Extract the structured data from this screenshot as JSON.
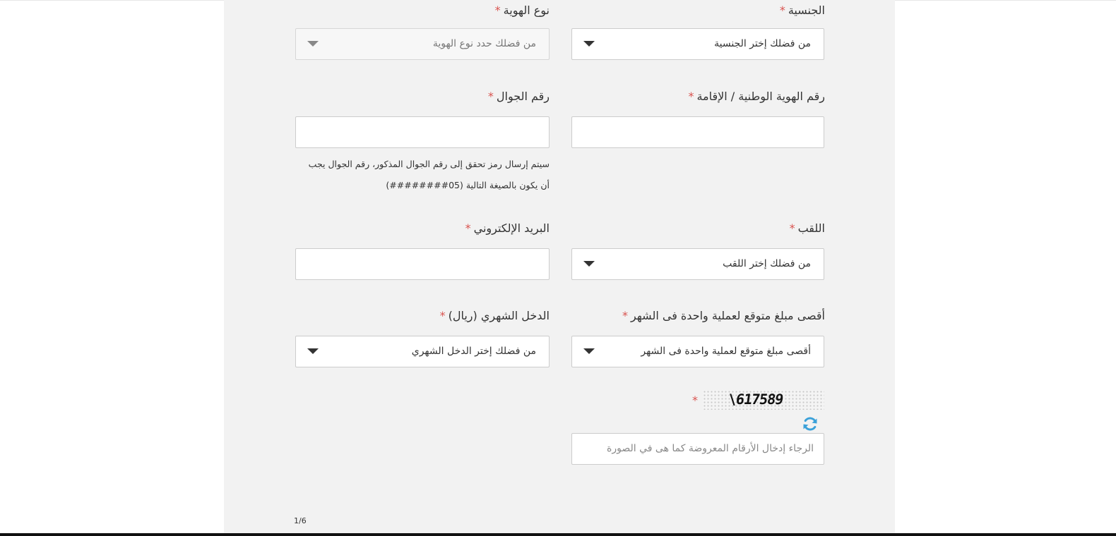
{
  "nationality": {
    "label": "الجنسية",
    "required": "*",
    "placeholder": "من فضلك إختر الجنسية"
  },
  "id_type": {
    "label": "نوع الهوية",
    "required": "*",
    "placeholder": "من فضلك حدد نوع الهوية"
  },
  "national_id": {
    "label": "رقم الهوية الوطنية / الإقامة",
    "required": "*",
    "value": ""
  },
  "mobile": {
    "label": "رقم الجوال",
    "required": "*",
    "value": "",
    "help_line1": "سيتم إرسال رمز تحقق إلى رقم الجوال المذكور، رقم الجوال يجب",
    "help_line2": "أن يكون بالصيغة التالية  (05########)"
  },
  "title": {
    "label": "اللقب",
    "required": "*",
    "placeholder": "من فضلك إختر اللقب"
  },
  "email": {
    "label": "البريد الإلكتروني",
    "required": "*",
    "value": ""
  },
  "max_amount": {
    "label": "أقصى مبلغ متوقع لعملية واحدة فى الشهر",
    "required": "*",
    "placeholder": "أقصى مبلغ متوقع لعملية واحدة فى الشهر"
  },
  "monthly_income": {
    "label": "الدخل الشهري (ريال)",
    "required": "*",
    "placeholder": "من فضلك إختر الدخل الشهري"
  },
  "captcha": {
    "required": "*",
    "image_text": "\\617589",
    "input_placeholder": "الرجاء إدخال الأرقام المعروضة كما هى في الصورة",
    "refresh_icon": "refresh-icon",
    "refresh_color": "#3ba1d9"
  },
  "pager": {
    "text": "1/6"
  },
  "colors": {
    "panel": "#f2f2f2",
    "required": "#d9534f",
    "border": "#cccccc"
  }
}
